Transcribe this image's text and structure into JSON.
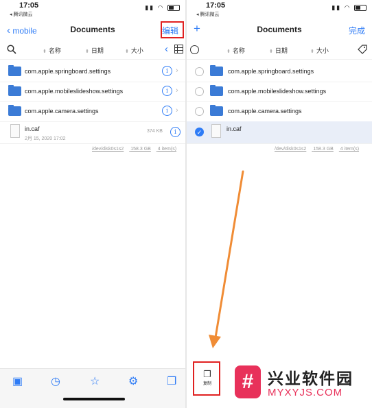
{
  "status": {
    "time": "17:05",
    "carrier": "◂ 腾讯微云"
  },
  "left": {
    "back_label": "mobile",
    "title": "Documents",
    "edit_label": "编辑",
    "sort": [
      "名称",
      "日期",
      "大小"
    ],
    "rows": [
      {
        "name": "com.apple.springboard.settings"
      },
      {
        "name": "com.apple.mobileslideshow.settings"
      },
      {
        "name": "com.apple.camera.settings"
      }
    ],
    "file": {
      "name": "in.caf",
      "date": "2月 15, 2020 17:02",
      "size": "374 KB"
    },
    "footer": {
      "device": "/dev/disk0s1s2",
      "space": "158.3 GB",
      "items": "4 item(s)"
    }
  },
  "right": {
    "add_label": "+",
    "title": "Documents",
    "done_label": "完成",
    "sort": [
      "名称",
      "日期",
      "大小"
    ],
    "rows": [
      {
        "name": "com.apple.springboard.settings"
      },
      {
        "name": "com.apple.mobileslideshow.settings"
      },
      {
        "name": "com.apple.camera.settings"
      }
    ],
    "file": {
      "name": "in.caf",
      "selected": true
    },
    "footer": {
      "device": "/dev/disk0s1s2",
      "space": "158.3 GB",
      "items": "4 item(s)"
    },
    "copy_label": "复制"
  },
  "tabbar": [
    "app-icon",
    "clock-icon",
    "star-icon",
    "gear-icon",
    "windows-icon"
  ],
  "watermark": {
    "title": "兴业软件园",
    "subtitle": "MYXYJS.COM"
  },
  "colors": {
    "accent": "#2f7cf6",
    "folder": "#3b7bd6",
    "highlight": "#e02020",
    "arrow": "#f08c35",
    "watermark": "#e8315a"
  }
}
